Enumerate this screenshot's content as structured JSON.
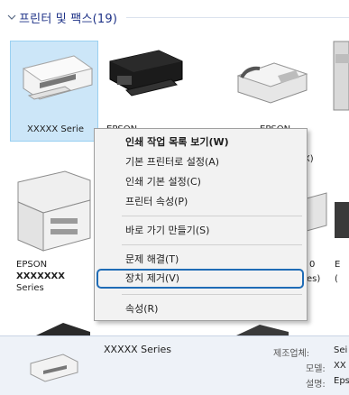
{
  "group": {
    "title": "프린터 및 팩스(19)"
  },
  "devices": {
    "d1": {
      "label": "XXXXX Serie"
    },
    "d2": {
      "label": "EPSON"
    },
    "d3": {
      "label": "EPSON"
    },
    "d3b": {
      "label": "AX)"
    },
    "d5": {
      "label": "EPSON"
    },
    "d5b": {
      "label": "XXXXXXX"
    },
    "d5c": {
      "label": "Series"
    },
    "d6": {
      "label": "0"
    },
    "d6b": {
      "label": "es)"
    },
    "d7": {
      "label": "E"
    },
    "d7b": {
      "label": "("
    }
  },
  "context_menu": {
    "items": [
      {
        "label": "인쇄 작업 목록 보기(W)"
      },
      {
        "label": "기본 프린터로 설정(A)"
      },
      {
        "label": "인쇄 기본 설정(C)"
      },
      {
        "label": "프린터 속성(P)"
      },
      {
        "label": "바로 가기 만들기(S)"
      },
      {
        "label": "문제 해결(T)"
      },
      {
        "label": "장치 제거(V)"
      },
      {
        "label": "속성(R)"
      }
    ],
    "highlighted_item": "장치 제거(V)"
  },
  "details": {
    "device_name": "XXXXX Series",
    "manufacturer_label": "제조업체:",
    "manufacturer_value": "Sei",
    "model_label": "모델:",
    "model_value": "XX",
    "description_label": "설명:",
    "description_value": "Eps"
  },
  "colors": {
    "highlight_border": "#1f6cb6",
    "selection": "#cce6f8",
    "header_text": "#1e3287"
  }
}
